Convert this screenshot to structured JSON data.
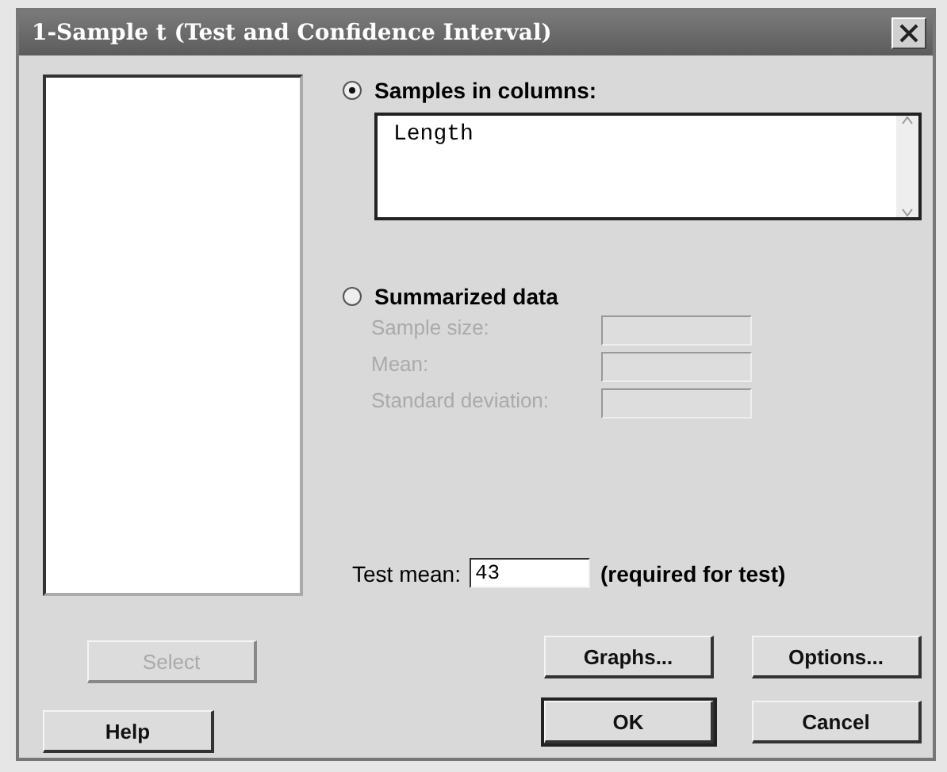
{
  "window": {
    "title": "1-Sample t (Test and Confidence Interval)"
  },
  "options": [
    {
      "kind": "columns",
      "label": "Samples in columns:",
      "selected": true,
      "value": "Length"
    },
    {
      "kind": "summarized",
      "label": "Summarized data",
      "selected": false,
      "fields": [
        {
          "label": "Sample size:",
          "disabled": true
        },
        {
          "label": "Mean:",
          "disabled": true
        },
        {
          "label": "Standard deviation:",
          "disabled": true
        }
      ]
    }
  ],
  "test_mean": {
    "label": "Test mean:",
    "value": "43",
    "note": "(required for test)"
  },
  "buttons": [
    {
      "label": "Select",
      "disabled": true
    },
    {
      "label": "Graphs...",
      "disabled": false
    },
    {
      "label": "Options...",
      "disabled": false
    },
    {
      "label": "Help",
      "disabled": false
    },
    {
      "label": "OK",
      "disabled": false,
      "default": true
    },
    {
      "label": "Cancel",
      "disabled": false
    }
  ]
}
